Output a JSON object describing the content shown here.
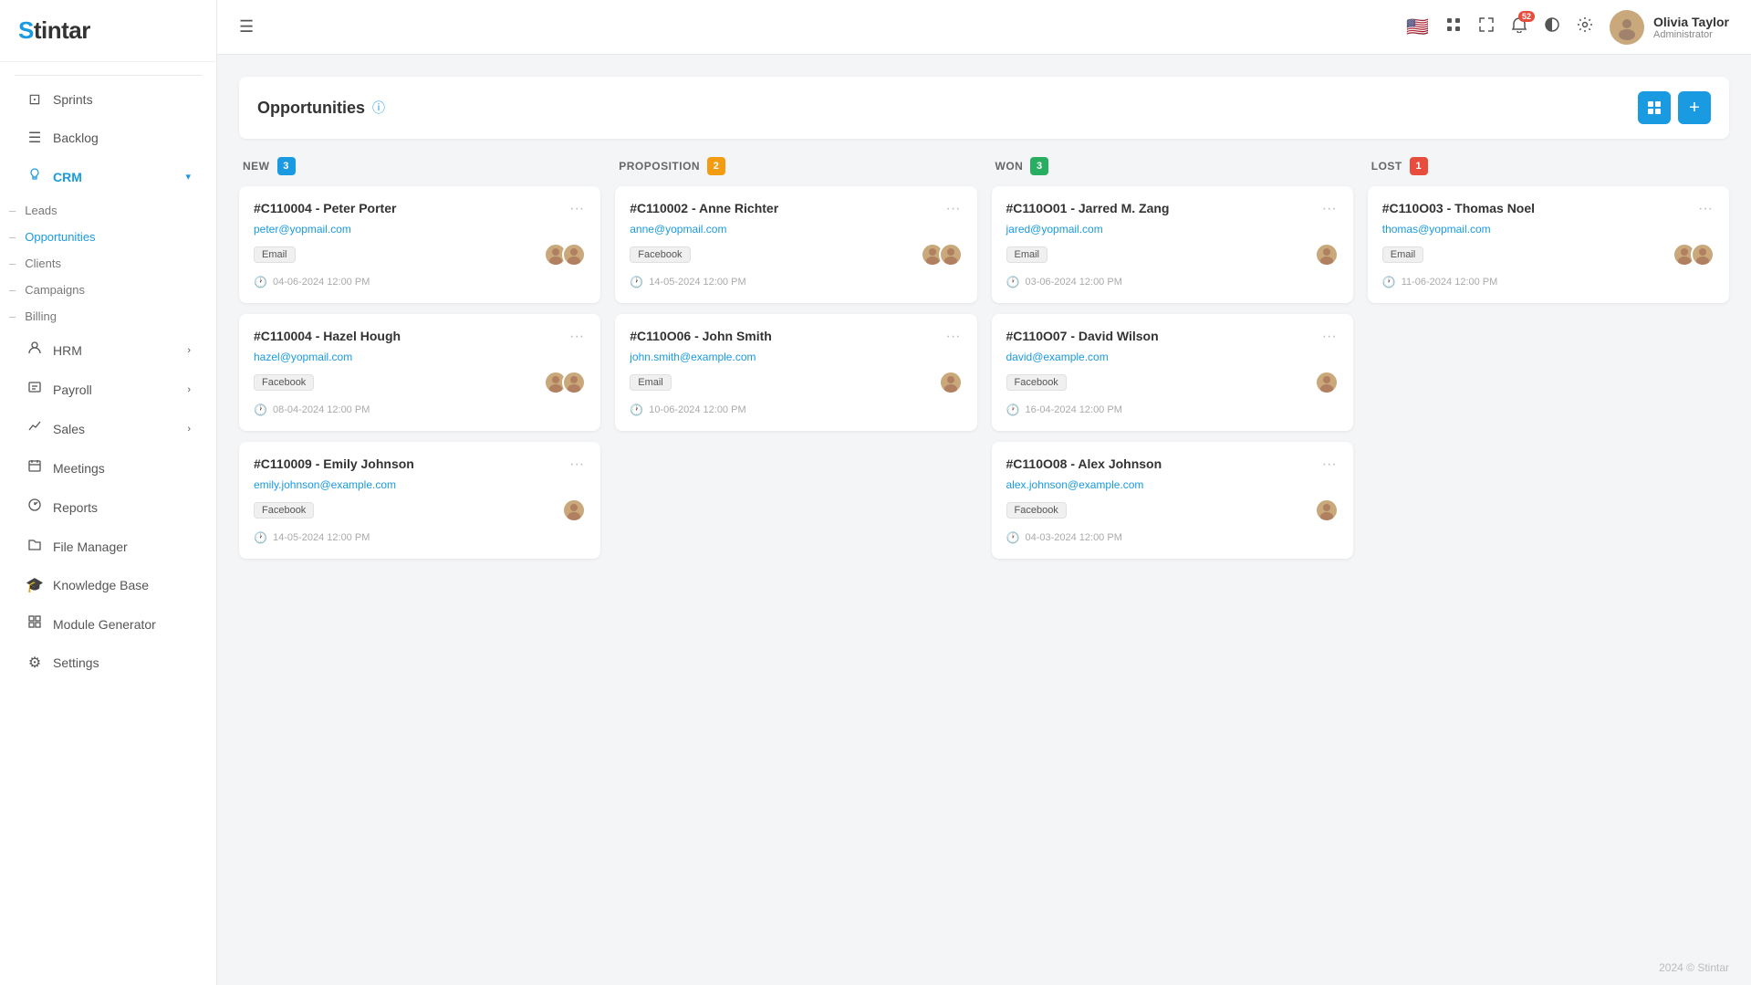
{
  "app": {
    "logo": "Stintar",
    "footer": "2024 © Stintar"
  },
  "sidebar": {
    "items": [
      {
        "id": "sprints",
        "label": "Sprints",
        "icon": "⊡"
      },
      {
        "id": "backlog",
        "label": "Backlog",
        "icon": "≡"
      },
      {
        "id": "crm",
        "label": "CRM",
        "icon": "⊙",
        "active": true,
        "hasArrow": true,
        "expanded": true
      },
      {
        "id": "hrm",
        "label": "HRM",
        "icon": "👤",
        "hasArrow": true
      },
      {
        "id": "payroll",
        "label": "Payroll",
        "icon": "📊",
        "hasArrow": true
      },
      {
        "id": "sales",
        "label": "Sales",
        "icon": "📈",
        "hasArrow": true
      },
      {
        "id": "meetings",
        "label": "Meetings",
        "icon": "📅"
      },
      {
        "id": "reports",
        "label": "Reports",
        "icon": "📉"
      },
      {
        "id": "file-manager",
        "label": "File Manager",
        "icon": "📁"
      },
      {
        "id": "knowledge-base",
        "label": "Knowledge Base",
        "icon": "🎓"
      },
      {
        "id": "module-generator",
        "label": "Module Generator",
        "icon": "⊞"
      },
      {
        "id": "settings",
        "label": "Settings",
        "icon": "⚙"
      }
    ],
    "crm_sub": [
      {
        "id": "leads",
        "label": "Leads"
      },
      {
        "id": "opportunities",
        "label": "Opportunities",
        "active": true
      },
      {
        "id": "clients",
        "label": "Clients"
      },
      {
        "id": "campaigns",
        "label": "Campaigns"
      },
      {
        "id": "billing",
        "label": "Billing"
      }
    ]
  },
  "header": {
    "menu_icon": "☰",
    "flag": "🇺🇸",
    "notification_count": "52",
    "user": {
      "name": "Olivia Taylor",
      "role": "Administrator",
      "avatar": "👤"
    }
  },
  "page": {
    "title": "Opportunities",
    "grid_button": "⊞",
    "add_button": "+"
  },
  "kanban": {
    "columns": [
      {
        "id": "new",
        "label": "NEW",
        "count": "3",
        "badge_class": "badge-blue",
        "cards": [
          {
            "id": "C110004-peter",
            "code": "#C110004 - Peter Porter",
            "email": "peter@yopmail.com",
            "tag": "Email",
            "avatars": 2,
            "time": "04-06-2024 12:00 PM"
          },
          {
            "id": "C110004-hazel",
            "code": "#C110004 - Hazel Hough",
            "email": "hazel@yopmail.com",
            "tag": "Facebook",
            "avatars": 2,
            "time": "08-04-2024 12:00 PM"
          },
          {
            "id": "C110009",
            "code": "#C110009 - Emily Johnson",
            "email": "emily.johnson@example.com",
            "tag": "Facebook",
            "avatars": 1,
            "time": "14-05-2024 12:00 PM"
          }
        ]
      },
      {
        "id": "proposition",
        "label": "PROPOSITION",
        "count": "2",
        "badge_class": "badge-orange",
        "cards": [
          {
            "id": "C110002",
            "code": "#C110002 - Anne Richter",
            "email": "anne@yopmail.com",
            "tag": "Facebook",
            "avatars": 2,
            "time": "14-05-2024 12:00 PM"
          },
          {
            "id": "C110006",
            "code": "#C110O06 - John Smith",
            "email": "john.smith@example.com",
            "tag": "Email",
            "avatars": 1,
            "time": "10-06-2024 12:00 PM"
          }
        ]
      },
      {
        "id": "won",
        "label": "WON",
        "count": "3",
        "badge_class": "badge-green",
        "cards": [
          {
            "id": "C110001",
            "code": "#C110O01 - Jarred M. Zang",
            "email": "jared@yopmail.com",
            "tag": "Email",
            "avatars": 1,
            "time": "03-06-2024 12:00 PM"
          },
          {
            "id": "C110007",
            "code": "#C110O07 - David Wilson",
            "email": "david@example.com",
            "tag": "Facebook",
            "avatars": 1,
            "time": "16-04-2024 12:00 PM"
          },
          {
            "id": "C110008",
            "code": "#C110O08 - Alex Johnson",
            "email": "alex.johnson@example.com",
            "tag": "Facebook",
            "avatars": 1,
            "time": "04-03-2024 12:00 PM"
          }
        ]
      },
      {
        "id": "lost",
        "label": "LOST",
        "count": "1",
        "badge_class": "badge-red",
        "cards": [
          {
            "id": "C110003",
            "code": "#C110O03 - Thomas Noel",
            "email": "thomas@yopmail.com",
            "tag": "Email",
            "avatars": 2,
            "time": "11-06-2024 12:00 PM"
          }
        ]
      }
    ]
  }
}
